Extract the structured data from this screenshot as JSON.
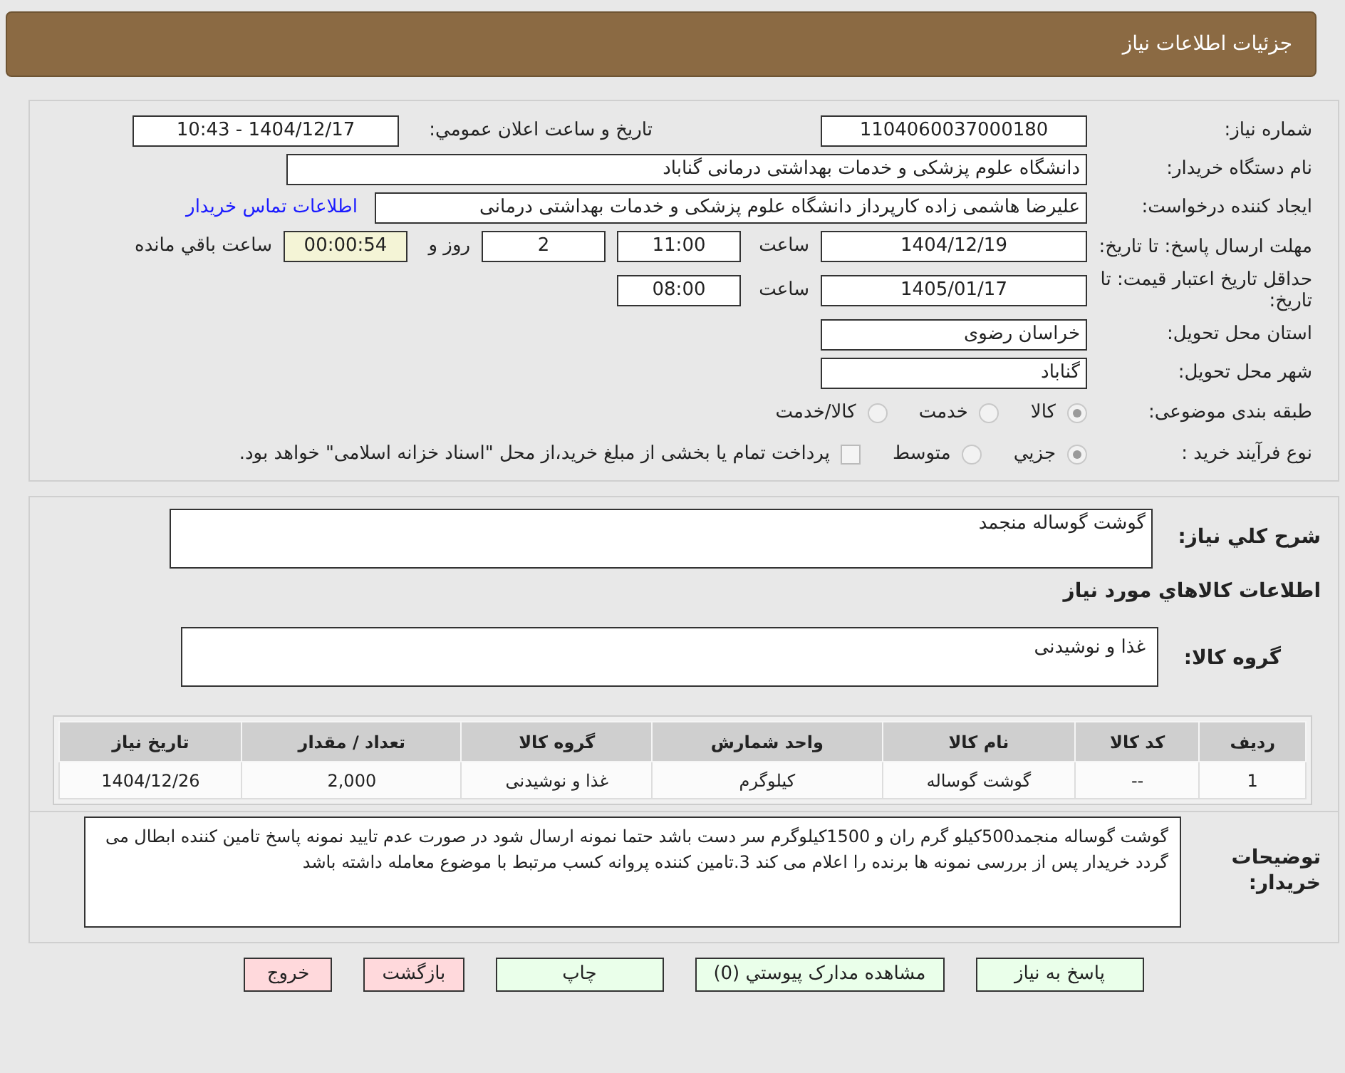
{
  "header": {
    "title": "جزئيات اطلاعات نیاز"
  },
  "need_number": {
    "label": "شماره نياز:",
    "value": "1104060037000180"
  },
  "announce": {
    "label": "تاريخ و ساعت اعلان عمومي:",
    "value": "1404/12/17 - 10:43"
  },
  "buyer": {
    "label": "نام دستگاه خريدار:",
    "value": "دانشگاه علوم پزشکی و خدمات بهداشتی درمانی گناباد"
  },
  "requester": {
    "label": "ايجاد کننده درخواست:",
    "value": "علیرضا هاشمی زاده کارپرداز دانشگاه علوم پزشکی و خدمات بهداشتی درمانی",
    "link": "اطلاعات تماس خريدار"
  },
  "deadline": {
    "label": "مهلت ارسال پاسخ: تا تاریخ:",
    "date": "1404/12/19",
    "time_label": "ساعت",
    "time": "11:00",
    "days": "2",
    "days_label": "روز و",
    "remaining": "00:00:54",
    "remaining_label": "ساعت باقي مانده"
  },
  "validity": {
    "label": "حداقل تاريخ اعتبار قيمت: تا تاريخ:",
    "date": "1405/01/17",
    "time_label": "ساعت",
    "time": "08:00"
  },
  "province": {
    "label": "استان محل تحويل:",
    "value": "خراسان رضوی"
  },
  "city": {
    "label": "شهر محل تحويل:",
    "value": "گناباد"
  },
  "category": {
    "label": "طبقه بندی موضوعی:",
    "options": [
      {
        "label": "کالا",
        "selected": true
      },
      {
        "label": "خدمت",
        "selected": false
      },
      {
        "label": "کالا/خدمت",
        "selected": false
      }
    ]
  },
  "process": {
    "label": "نوع فرآيند خريد :",
    "options": [
      {
        "label": "جزيي",
        "selected": true
      },
      {
        "label": "متوسط",
        "selected": false
      }
    ],
    "payment": {
      "label": "پرداخت تمام يا بخشی از مبلغ خريد،از محل \"اسناد خزانه اسلامی\" خواهد بود.",
      "checked": false
    }
  },
  "description": {
    "label": "شرح کلي نياز:",
    "value": "گوشت گوساله منجمد"
  },
  "goods_title": "اطلاعات کالاهاي مورد نياز",
  "goods_group": {
    "label": "گروه کالا:",
    "value": "غذا و نوشیدنی"
  },
  "table": {
    "columns": [
      "رديف",
      "کد کالا",
      "نام کالا",
      "واحد شمارش",
      "گروه کالا",
      "تعداد / مقدار",
      "تاريخ نياز"
    ],
    "rows": [
      [
        "1",
        "--",
        "گوشت گوساله",
        "کیلوگرم",
        "غذا و نوشیدنی",
        "2,000",
        "1404/12/26"
      ]
    ]
  },
  "notes": {
    "label": "توضيحات خريدار:",
    "value": "گوشت گوساله منجمد500کیلو گرم ران و 1500کیلوگرم  سر دست باشد حتما نمونه ارسال شود در صورت عدم تایید نمونه پاسخ  تامین کننده ابطال می گردد خریدار پس از بررسی نمونه ها برنده را اعلام می کند 3.تامین کننده پروانه کسب  مرتبط با موضوع معامله داشته باشد"
  },
  "buttons": [
    {
      "label": "پاسخ به نياز",
      "kind": "primary"
    },
    {
      "label": "مشاهده مدارک پيوستي (0)",
      "kind": "primary"
    },
    {
      "label": "چاپ",
      "kind": "primary"
    },
    {
      "label": "بازگشت",
      "kind": "danger"
    },
    {
      "label": "خروج",
      "kind": "danger"
    }
  ]
}
